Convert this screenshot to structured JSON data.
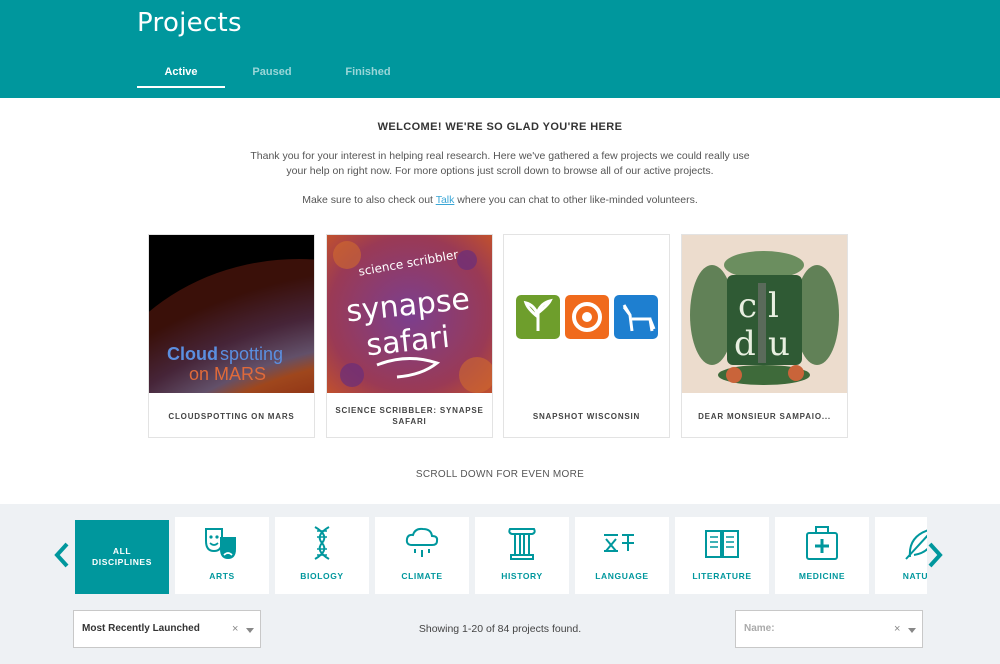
{
  "header": {
    "title": "Projects",
    "tabs": [
      {
        "label": "Active",
        "active": true
      },
      {
        "label": "Paused",
        "active": false
      },
      {
        "label": "Finished",
        "active": false
      }
    ],
    "accent_color": "#00979d"
  },
  "welcome": {
    "heading": "WELCOME! WE'RE SO GLAD YOU'RE HERE",
    "paragraph": "Thank you for your interest in helping real research. Here we've gathered a few projects we could really use your help on right now. For more options just scroll down to browse all of our active projects.",
    "talk_prefix": "Make sure to also check out ",
    "talk_link": "Talk",
    "talk_suffix": " where you can chat to other like-minded volunteers."
  },
  "featured_projects": [
    {
      "title": "CLOUDSPOTTING ON MARS",
      "image_text_1": "Cloud",
      "image_text_2": "spotting",
      "image_text_3": "on MARS"
    },
    {
      "title": "SCIENCE SCRIBBLER: SYNAPSE SAFARI",
      "image_text_1": "science scribbler",
      "image_text_2": "synapse",
      "image_text_3": "safari"
    },
    {
      "title": "SNAPSHOT WISCONSIN"
    },
    {
      "title": "DEAR MONSIEUR SAMPAIO..."
    }
  ],
  "scroll_more": "SCROLL DOWN FOR EVEN MORE",
  "disciplines": {
    "all_label": "ALL DISCIPLINES",
    "items": [
      {
        "label": "ARTS",
        "icon": "theater-masks-icon"
      },
      {
        "label": "BIOLOGY",
        "icon": "dna-icon"
      },
      {
        "label": "CLIMATE",
        "icon": "rain-cloud-icon"
      },
      {
        "label": "HISTORY",
        "icon": "column-icon"
      },
      {
        "label": "LANGUAGE",
        "icon": "glyphs-icon"
      },
      {
        "label": "LITERATURE",
        "icon": "open-book-icon"
      },
      {
        "label": "MEDICINE",
        "icon": "medical-kit-icon"
      },
      {
        "label": "NATURE",
        "icon": "leaf-icon"
      }
    ]
  },
  "filters": {
    "sort_value": "Most Recently Launched",
    "results": "Showing 1-20 of 84 projects found.",
    "name_placeholder": "Name:",
    "clear_symbol": "×"
  }
}
